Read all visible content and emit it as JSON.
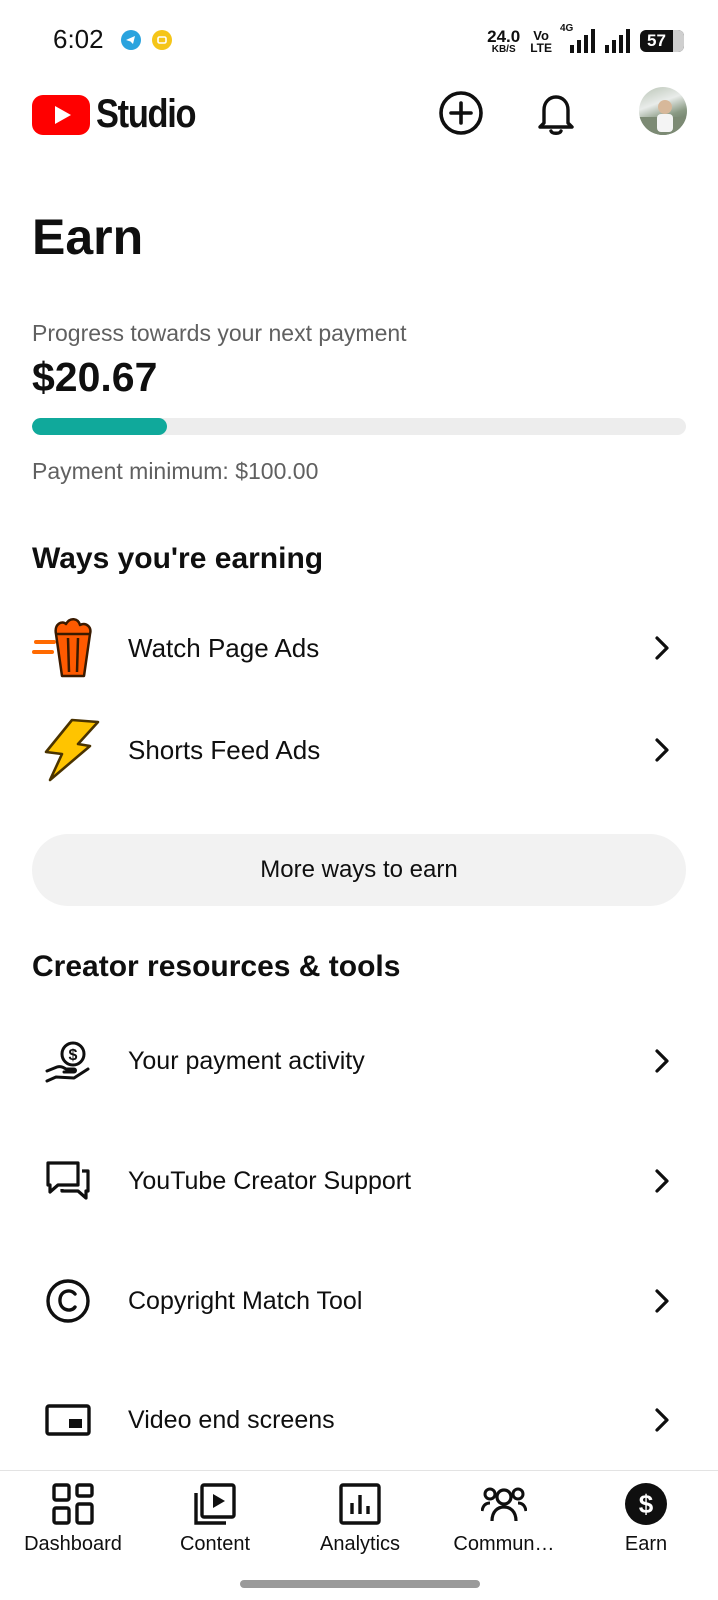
{
  "status_bar": {
    "time": "6:02",
    "net_speed_value": "24.0",
    "net_speed_unit": "KB/S",
    "volte_top": "Vo",
    "volte_bottom": "LTE",
    "network_label": "4G",
    "battery": "57"
  },
  "app_bar": {
    "brand": "Studio",
    "brand_color": "#ff0000"
  },
  "page": {
    "title": "Earn"
  },
  "payment_progress": {
    "label": "Progress towards your next payment",
    "amount": "$20.67",
    "minimum_label": "Payment minimum: $100.00",
    "progress_fraction": 0.2067,
    "fill_color": "#10a99b"
  },
  "ways_earning": {
    "title": "Ways you're earning",
    "items": [
      {
        "label": "Watch Page Ads",
        "icon": "popcorn-icon"
      },
      {
        "label": "Shorts Feed Ads",
        "icon": "lightning-icon"
      }
    ],
    "more_button_label": "More ways to earn"
  },
  "creator_tools": {
    "title": "Creator resources & tools",
    "items": [
      {
        "label": "Your payment activity",
        "icon": "payment-hand-icon"
      },
      {
        "label": "YouTube Creator Support",
        "icon": "chat-bubbles-icon"
      },
      {
        "label": "Copyright Match Tool",
        "icon": "copyright-icon"
      },
      {
        "label": "Video end screens",
        "icon": "end-screen-icon"
      }
    ]
  },
  "bottom_nav": {
    "items": [
      {
        "label": "Dashboard",
        "icon": "dashboard-icon"
      },
      {
        "label": "Content",
        "icon": "content-icon"
      },
      {
        "label": "Analytics",
        "icon": "analytics-icon"
      },
      {
        "label": "Commun…",
        "icon": "community-icon"
      },
      {
        "label": "Earn",
        "icon": "dollar-icon"
      }
    ],
    "active": "Earn"
  }
}
